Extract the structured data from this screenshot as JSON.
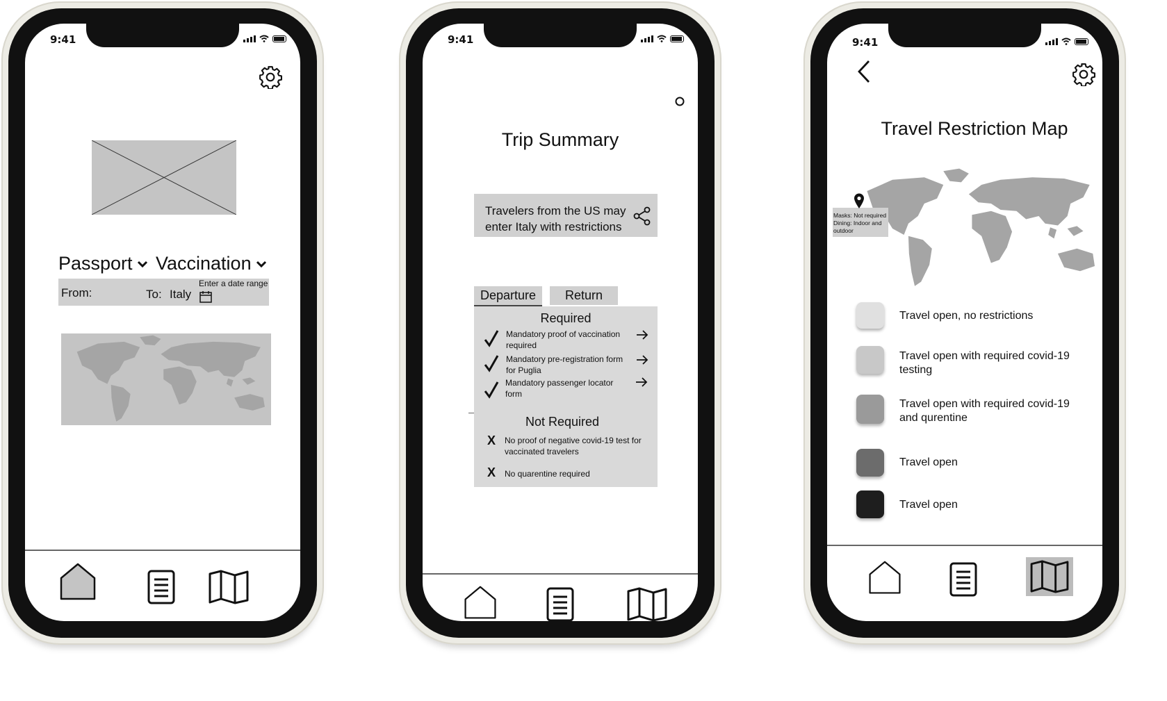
{
  "status": {
    "time": "9:41"
  },
  "screen1": {
    "passport_label": "Passport",
    "vaccination_label": "Vaccination",
    "from_label": "From:",
    "to_label": "To:",
    "to_value": "Italy",
    "date_placeholder": "Enter a date range"
  },
  "screen2": {
    "title": "Trip Summary",
    "notice": "Travelers from the US may enter Italy with restrictions",
    "tabs": [
      {
        "label": "Departure",
        "active": true
      },
      {
        "label": "Return",
        "active": false
      }
    ],
    "required_heading": "Required",
    "required_items": [
      "Mandatory proof of vaccination required",
      "Mandatory pre-registration form for Puglia",
      "Mandatory passenger locator form"
    ],
    "not_required_heading": "Not Required",
    "not_required_items": [
      "No proof of negative covid-19 test for vaccinated travelers",
      "No quarentine required"
    ]
  },
  "screen3": {
    "title": "Travel Restriction Map",
    "pin_info": "Masks: Not required Dining: Indoor and outdoor",
    "legend": [
      {
        "label": "Travel open, no restrictions",
        "color": "#e0e0e0"
      },
      {
        "label": "Travel open with required covid-19 testing",
        "color": "#c8c8c8"
      },
      {
        "label": "Travel open with required covid-19 and qurentine",
        "color": "#9a9a9a"
      },
      {
        "label": "Travel open",
        "color": "#6c6c6c"
      },
      {
        "label": "Travel open",
        "color": "#1e1e1e"
      }
    ]
  },
  "nav": {
    "items": [
      "home-icon",
      "document-icon",
      "map-icon"
    ]
  },
  "colors": {
    "placeholder_gray": "#c4c4c4",
    "panel_gray": "#d9d9d9",
    "frame": "#ecebe4",
    "bezel": "#111111"
  }
}
